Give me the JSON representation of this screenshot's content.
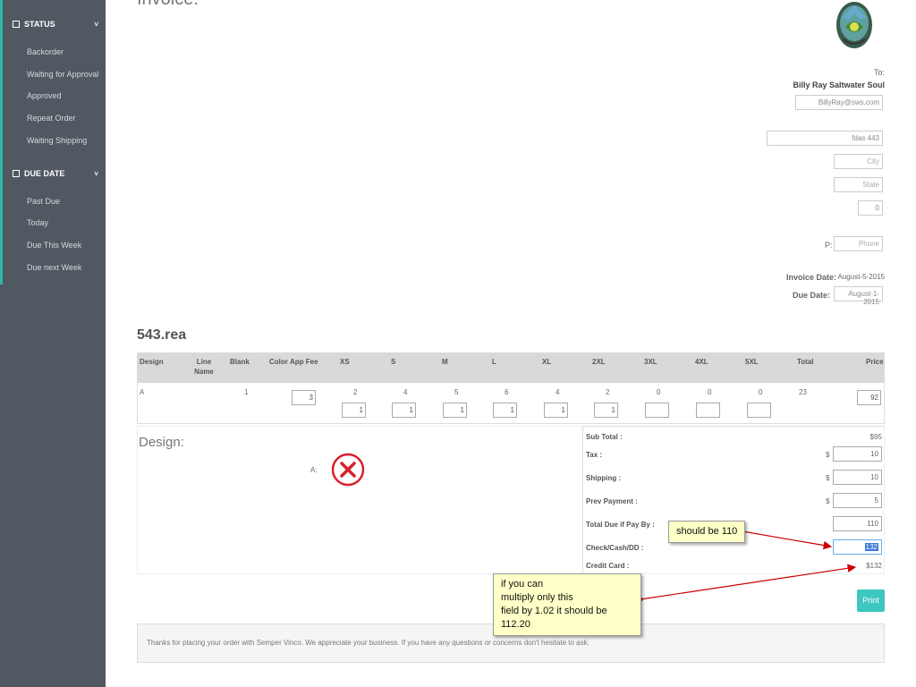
{
  "sidebar": {
    "status": {
      "label": "STATUS",
      "items": [
        "Backorder",
        "Waiting for Approval",
        "Approved",
        "Repeat Order",
        "Waiting Shipping"
      ]
    },
    "due_date": {
      "label": "DUE DATE",
      "items": [
        "Past Due",
        "Today",
        "Due This Week",
        "Due next Week"
      ]
    }
  },
  "invoice": {
    "title": "Invoice:",
    "to_label": "To:",
    "customer_name": "Billy Ray Saltwater Soul",
    "email": "BillyRay@sws.com",
    "address": "fdas 443",
    "city_placeholder": "City",
    "state_placeholder": "State",
    "zip": "0",
    "phone_label": "P:",
    "phone_placeholder": "Phone",
    "invoice_date_label": "Invoice Date:",
    "invoice_date": "August-5-2015",
    "due_date_label": "Due Date:",
    "due_date": "August-1-2015"
  },
  "order": {
    "name": "543.rea",
    "columns": [
      "Design",
      "Line Name",
      "Blank",
      "Color",
      "App Fee",
      "XS",
      "S",
      "M",
      "L",
      "XL",
      "2XL",
      "3XL",
      "4XL",
      "5XL",
      "Total",
      "Price"
    ],
    "row": {
      "design": "A",
      "blank": "1",
      "app_fee": "3",
      "sizes": [
        "2",
        "4",
        "5",
        "6",
        "4",
        "2",
        "0",
        "0",
        "0"
      ],
      "size_inputs": [
        "1",
        "1",
        "1",
        "1",
        "1",
        "1",
        "",
        "",
        ""
      ],
      "total": "23",
      "price": "92"
    }
  },
  "design": {
    "title": "Design:",
    "label_a": "A:"
  },
  "summary": {
    "subtotal_label": "Sub Total :",
    "subtotal": "$95",
    "tax_label": "Tax :",
    "tax": "10",
    "shipping_label": "Shipping :",
    "shipping": "10",
    "prev_payment_label": "Prev Payment :",
    "prev_payment": "5",
    "total_due_label": "Total Due if Pay By :",
    "total_due": "110",
    "check_label": "Check/Cash/DD :",
    "check": "132",
    "credit_label": "Credit Card :",
    "credit": "$132",
    "dollar": "$"
  },
  "print_label": "Print",
  "footer_text": "Thanks for placing your order with Semper Vinco. We appreciate your business. If you have any questions or concerns don't hesitate to ask.",
  "callouts": {
    "c1": "should be 110",
    "c2_line1": "if you can",
    "c2_line2": "multiply only this",
    "c2_line3": "field by 1.02 it should be 112.20"
  },
  "colors": {
    "sidebar_bg": "#505862",
    "accent": "#2fb8a8",
    "print_button": "#3ec6c0",
    "callout_bg": "#ffffc8",
    "arrow": "#cc0000",
    "remove_icon": "#d9202b"
  }
}
